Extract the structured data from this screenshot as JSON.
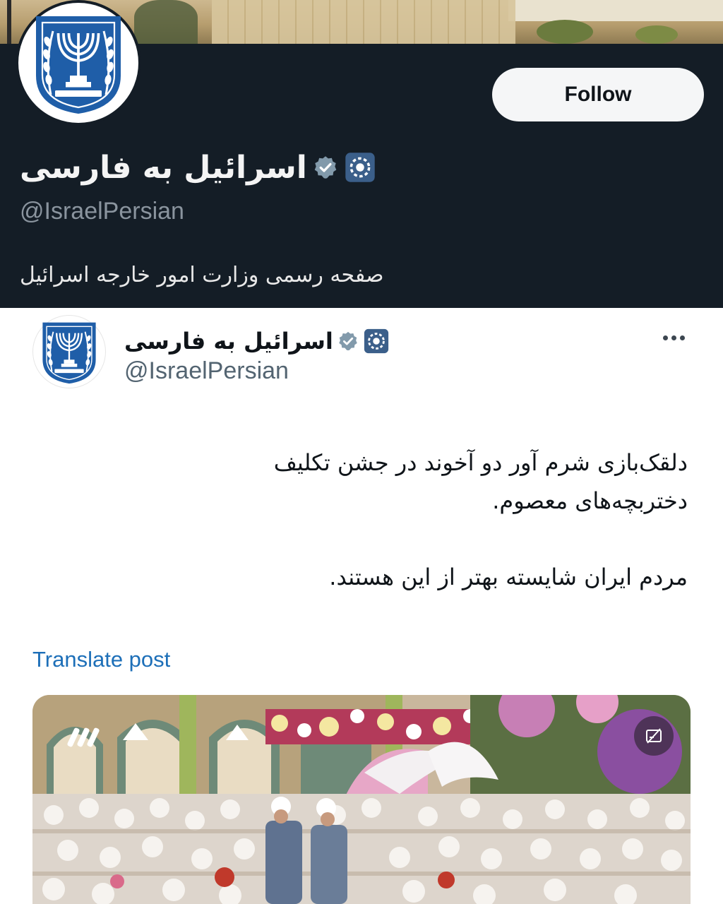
{
  "profile": {
    "display_name": "اسرائیل به فارسی",
    "handle": "@IsraelPersian",
    "bio": "صفحه رسمی وزارت امور خارجه اسرائیل",
    "follow_label": "Follow"
  },
  "tweet": {
    "display_name": "اسرائیل به فارسی",
    "handle": "@IsraelPersian",
    "text_line1": "دلقک‌بازی شرم آور دو آخوند در جشن تکلیف",
    "text_line2": "دختربچه‌های معصوم.",
    "text_line3": "مردم ایران شایسته بهتر از این هستند.",
    "translate_label": "Translate post"
  },
  "icons": {
    "avatar": "state-emblem-menorah-icon",
    "gov_badge": "government-badge-icon",
    "verified": "verified-badge-icon",
    "more": "more-options-icon",
    "media_settings": "caption-toggle-icon"
  },
  "colors": {
    "profile_bg": "#141d26",
    "link": "#1d6fb8",
    "emblem_blue": "#1f5ea8"
  }
}
